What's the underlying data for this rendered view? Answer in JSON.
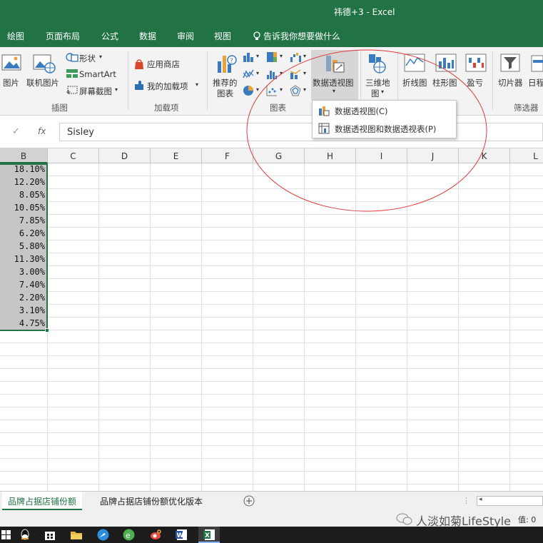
{
  "window": {
    "title": "祎德+3  -  Excel",
    "accent": "#217346"
  },
  "menu": {
    "items": [
      "绘图",
      "页面布局",
      "公式",
      "数据",
      "审阅",
      "视图"
    ],
    "tell_me": "告诉我你想要做什么"
  },
  "ribbon": {
    "illustrations": {
      "pictures": "图片",
      "online_pictures": "联机图片",
      "shapes": "形状",
      "smartart": "SmartArt",
      "screenshot": "屏幕截图",
      "group": "插图"
    },
    "addins": {
      "store": "应用商店",
      "my_addins": "我的加载项",
      "group": "加载项"
    },
    "charts": {
      "recommended_line1": "推荐的",
      "recommended_line2": "图表",
      "pivot_chart": "数据透视图",
      "group": "图表"
    },
    "tours": {
      "map_line1": "三维地",
      "map_line2": "图"
    },
    "sparklines": {
      "line": "折线图",
      "column": "柱形图",
      "winloss": "盈亏"
    },
    "filters": {
      "slicer": "切片器",
      "timeline": "日程",
      "group": "筛选器"
    }
  },
  "pivot_menu": {
    "items": [
      {
        "label": "数据透视图(C)"
      },
      {
        "label": "数据透视图和数据透视表(P)"
      }
    ]
  },
  "formula_bar": {
    "cancel_icon": "✓",
    "fx": "fx",
    "value": "Sisley"
  },
  "grid": {
    "columns": [
      "B",
      "C",
      "D",
      "E",
      "F",
      "G",
      "H",
      "I",
      "J",
      "K",
      "L"
    ],
    "selected_column": "B",
    "b_values": [
      "18.10%",
      "12.20%",
      "8.05%",
      "10.05%",
      "7.85%",
      "6.20%",
      "5.80%",
      "11.30%",
      "3.00%",
      "7.40%",
      "2.20%",
      "3.10%",
      "4.75%"
    ]
  },
  "sheets": {
    "tabs": [
      "品牌占据店铺份额",
      "品牌占据店铺份额优化版本"
    ],
    "active": 0,
    "add_icon": "plus-icon"
  },
  "status": {
    "right_text": "值: 0"
  },
  "watermark": {
    "text": "人淡如菊LifeStyle"
  }
}
